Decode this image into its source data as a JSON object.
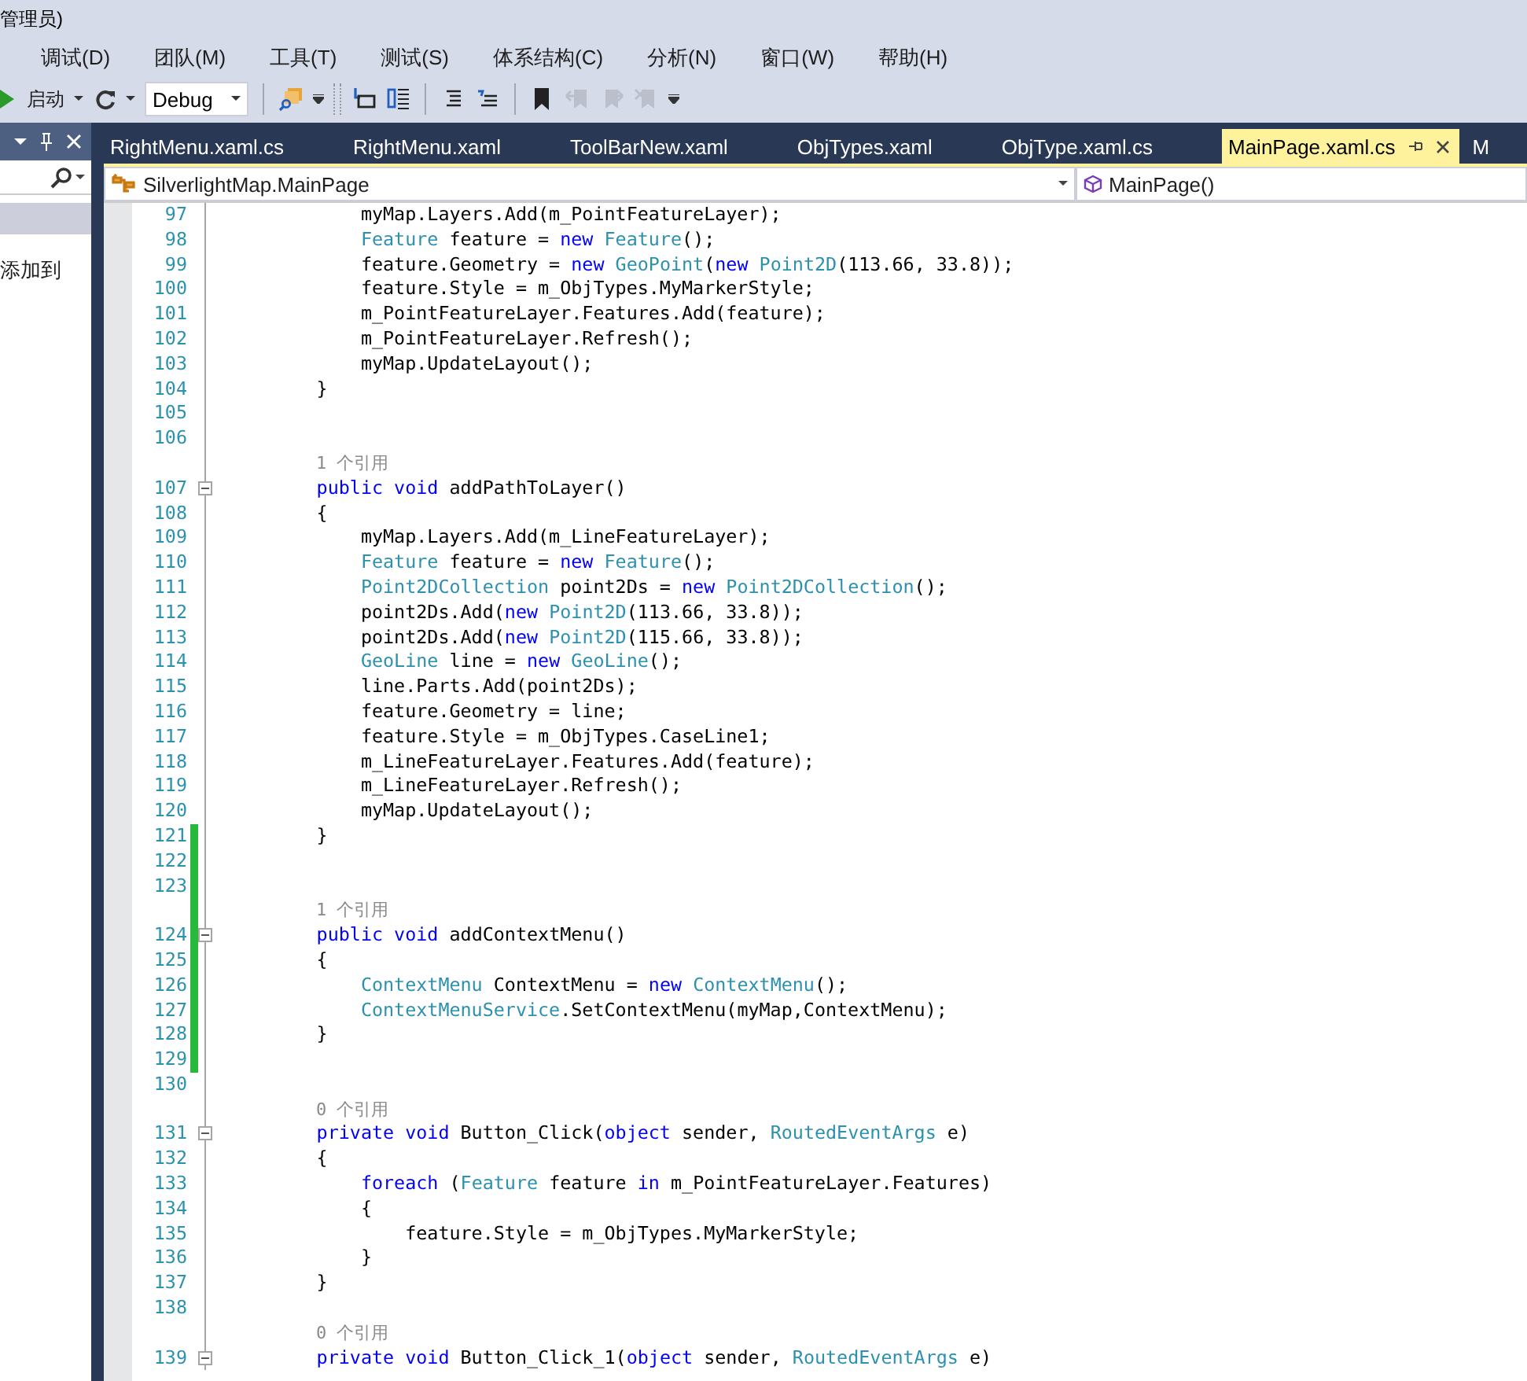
{
  "window": {
    "title": "管理员)"
  },
  "menu": [
    "调试(D)",
    "团队(M)",
    "工具(T)",
    "测试(S)",
    "体系结构(C)",
    "分析(N)",
    "窗口(W)",
    "帮助(H)"
  ],
  "toolbar": {
    "start_label": "启动",
    "configuration": "Debug",
    "buttons": [
      {
        "disabled": false
      },
      {
        "disabled": false
      },
      {
        "disabled": false
      },
      {
        "disabled": false
      },
      {
        "disabled": false
      },
      {
        "disabled": false
      },
      {
        "disabled": true
      },
      {
        "disabled": true
      },
      {
        "disabled": true
      }
    ]
  },
  "side_panel": {
    "selected_row": true,
    "text": "添加到"
  },
  "tabs": [
    {
      "label": "RightMenu.xaml.cs",
      "selected": false
    },
    {
      "label": "RightMenu.xaml",
      "selected": false
    },
    {
      "label": "ToolBarNew.xaml",
      "selected": false
    },
    {
      "label": "ObjTypes.xaml",
      "selected": false
    },
    {
      "label": "ObjType.xaml.cs",
      "selected": false
    },
    {
      "label": "MainPage.xaml.cs",
      "selected": true
    },
    {
      "label": "M",
      "selected": false
    }
  ],
  "navigation": {
    "type": "SilverlightMap.MainPage",
    "member": "MainPage()"
  },
  "code": [
    {
      "number": "97",
      "changed": false,
      "fold": false,
      "code": [
        {
          "kind": "plain",
          "text": "            myMap.Layers.Add(m_PointFeatureLayer);"
        }
      ]
    },
    {
      "number": "98",
      "changed": false,
      "fold": false,
      "code": [
        {
          "kind": "type",
          "text": "            Feature"
        },
        {
          "kind": "plain",
          "text": " feature = "
        },
        {
          "kind": "keyword",
          "text": "new "
        },
        {
          "kind": "type",
          "text": "Feature"
        },
        {
          "kind": "plain",
          "text": "();"
        }
      ]
    },
    {
      "number": "99",
      "changed": false,
      "fold": false,
      "code": [
        {
          "kind": "plain",
          "text": "            feature.Geometry = "
        },
        {
          "kind": "keyword",
          "text": "new "
        },
        {
          "kind": "type",
          "text": "GeoPoint"
        },
        {
          "kind": "plain",
          "text": "("
        },
        {
          "kind": "keyword",
          "text": "new "
        },
        {
          "kind": "type",
          "text": "Point2D"
        },
        {
          "kind": "plain",
          "text": "(113.66, 33.8));"
        }
      ]
    },
    {
      "number": "100",
      "changed": false,
      "fold": false,
      "code": [
        {
          "kind": "plain",
          "text": "            feature.Style = m_ObjTypes.MyMarkerStyle;"
        }
      ]
    },
    {
      "number": "101",
      "changed": false,
      "fold": false,
      "code": [
        {
          "kind": "plain",
          "text": "            m_PointFeatureLayer.Features.Add(feature);"
        }
      ]
    },
    {
      "number": "102",
      "changed": false,
      "fold": false,
      "code": [
        {
          "kind": "plain",
          "text": "            m_PointFeatureLayer.Refresh();"
        }
      ]
    },
    {
      "number": "103",
      "changed": false,
      "fold": false,
      "code": [
        {
          "kind": "plain",
          "text": "            myMap.UpdateLayout();"
        }
      ]
    },
    {
      "number": "104",
      "changed": false,
      "fold": false,
      "code": [
        {
          "kind": "plain",
          "text": "        }"
        }
      ]
    },
    {
      "number": "105",
      "changed": false,
      "fold": false
    },
    {
      "number": "106",
      "changed": false,
      "fold": false
    },
    {
      "kind": "codelens",
      "changed": false,
      "text": "1 个引用"
    },
    {
      "number": "107",
      "changed": false,
      "fold": true,
      "code": [
        {
          "kind": "keyword",
          "text": "        public void"
        },
        {
          "kind": "plain",
          "text": " addPathToLayer()"
        }
      ]
    },
    {
      "number": "108",
      "changed": false,
      "fold": false,
      "code": [
        {
          "kind": "plain",
          "text": "        {"
        }
      ]
    },
    {
      "number": "109",
      "changed": false,
      "fold": false,
      "code": [
        {
          "kind": "plain",
          "text": "            myMap.Layers.Add(m_LineFeatureLayer);"
        }
      ]
    },
    {
      "number": "110",
      "changed": false,
      "fold": false,
      "code": [
        {
          "kind": "type",
          "text": "            Feature"
        },
        {
          "kind": "plain",
          "text": " feature = "
        },
        {
          "kind": "keyword",
          "text": "new "
        },
        {
          "kind": "type",
          "text": "Feature"
        },
        {
          "kind": "plain",
          "text": "();"
        }
      ]
    },
    {
      "number": "111",
      "changed": false,
      "fold": false,
      "code": [
        {
          "kind": "type",
          "text": "            Point2DCollection"
        },
        {
          "kind": "plain",
          "text": " point2Ds = "
        },
        {
          "kind": "keyword",
          "text": "new "
        },
        {
          "kind": "type",
          "text": "Point2DCollection"
        },
        {
          "kind": "plain",
          "text": "();"
        }
      ]
    },
    {
      "number": "112",
      "changed": false,
      "fold": false,
      "code": [
        {
          "kind": "plain",
          "text": "            point2Ds.Add("
        },
        {
          "kind": "keyword",
          "text": "new "
        },
        {
          "kind": "type",
          "text": "Point2D"
        },
        {
          "kind": "plain",
          "text": "(113.66, 33.8));"
        }
      ]
    },
    {
      "number": "113",
      "changed": false,
      "fold": false,
      "code": [
        {
          "kind": "plain",
          "text": "            point2Ds.Add("
        },
        {
          "kind": "keyword",
          "text": "new "
        },
        {
          "kind": "type",
          "text": "Point2D"
        },
        {
          "kind": "plain",
          "text": "(115.66, 33.8));"
        }
      ]
    },
    {
      "number": "114",
      "changed": false,
      "fold": false,
      "code": [
        {
          "kind": "type",
          "text": "            GeoLine"
        },
        {
          "kind": "plain",
          "text": " line = "
        },
        {
          "kind": "keyword",
          "text": "new "
        },
        {
          "kind": "type",
          "text": "GeoLine"
        },
        {
          "kind": "plain",
          "text": "();"
        }
      ]
    },
    {
      "number": "115",
      "changed": false,
      "fold": false,
      "code": [
        {
          "kind": "plain",
          "text": "            line.Parts.Add(point2Ds);"
        }
      ]
    },
    {
      "number": "116",
      "changed": false,
      "fold": false,
      "code": [
        {
          "kind": "plain",
          "text": "            feature.Geometry = line;"
        }
      ]
    },
    {
      "number": "117",
      "changed": false,
      "fold": false,
      "code": [
        {
          "kind": "plain",
          "text": "            feature.Style = m_ObjTypes.CaseLine1;"
        }
      ]
    },
    {
      "number": "118",
      "changed": false,
      "fold": false,
      "code": [
        {
          "kind": "plain",
          "text": "            m_LineFeatureLayer.Features.Add(feature);"
        }
      ]
    },
    {
      "number": "119",
      "changed": false,
      "fold": false,
      "code": [
        {
          "kind": "plain",
          "text": "            m_LineFeatureLayer.Refresh();"
        }
      ]
    },
    {
      "number": "120",
      "changed": false,
      "fold": false,
      "code": [
        {
          "kind": "plain",
          "text": "            myMap.UpdateLayout();"
        }
      ]
    },
    {
      "number": "121",
      "changed": true,
      "fold": false,
      "code": [
        {
          "kind": "plain",
          "text": "        }"
        }
      ]
    },
    {
      "number": "122",
      "changed": true,
      "fold": false
    },
    {
      "number": "123",
      "changed": true,
      "fold": false
    },
    {
      "kind": "codelens",
      "changed": true,
      "text": "1 个引用"
    },
    {
      "number": "124",
      "changed": true,
      "fold": true,
      "code": [
        {
          "kind": "keyword",
          "text": "        public void"
        },
        {
          "kind": "plain",
          "text": " addContextMenu()"
        }
      ]
    },
    {
      "number": "125",
      "changed": true,
      "fold": false,
      "code": [
        {
          "kind": "plain",
          "text": "        {"
        }
      ]
    },
    {
      "number": "126",
      "changed": true,
      "fold": false,
      "code": [
        {
          "kind": "type",
          "text": "            ContextMenu"
        },
        {
          "kind": "plain",
          "text": " ContextMenu = "
        },
        {
          "kind": "keyword",
          "text": "new "
        },
        {
          "kind": "type",
          "text": "ContextMenu"
        },
        {
          "kind": "plain",
          "text": "();"
        }
      ]
    },
    {
      "number": "127",
      "changed": true,
      "fold": false,
      "code": [
        {
          "kind": "type",
          "text": "            ContextMenuService"
        },
        {
          "kind": "plain",
          "text": ".SetContextMenu(myMap,ContextMenu);"
        }
      ]
    },
    {
      "number": "128",
      "changed": true,
      "fold": false,
      "code": [
        {
          "kind": "plain",
          "text": "        }"
        }
      ]
    },
    {
      "number": "129",
      "changed": true,
      "fold": false
    },
    {
      "number": "130",
      "changed": false,
      "fold": false
    },
    {
      "kind": "codelens",
      "changed": false,
      "text": "0 个引用"
    },
    {
      "number": "131",
      "changed": false,
      "fold": true,
      "code": [
        {
          "kind": "keyword",
          "text": "        private void"
        },
        {
          "kind": "plain",
          "text": " Button_Click("
        },
        {
          "kind": "keyword",
          "text": "object"
        },
        {
          "kind": "plain",
          "text": " sender, "
        },
        {
          "kind": "type",
          "text": "RoutedEventArgs"
        },
        {
          "kind": "plain",
          "text": " e)"
        }
      ]
    },
    {
      "number": "132",
      "changed": false,
      "fold": false,
      "code": [
        {
          "kind": "plain",
          "text": "        {"
        }
      ]
    },
    {
      "number": "133",
      "changed": false,
      "fold": false,
      "code": [
        {
          "kind": "keyword",
          "text": "            foreach"
        },
        {
          "kind": "plain",
          "text": " ("
        },
        {
          "kind": "type",
          "text": "Feature"
        },
        {
          "kind": "plain",
          "text": " feature "
        },
        {
          "kind": "keyword",
          "text": "in"
        },
        {
          "kind": "plain",
          "text": " m_PointFeatureLayer.Features)"
        }
      ]
    },
    {
      "number": "134",
      "changed": false,
      "fold": false,
      "code": [
        {
          "kind": "plain",
          "text": "            {"
        }
      ]
    },
    {
      "number": "135",
      "changed": false,
      "fold": false,
      "code": [
        {
          "kind": "plain",
          "text": "                feature.Style = m_ObjTypes.MyMarkerStyle;"
        }
      ]
    },
    {
      "number": "136",
      "changed": false,
      "fold": false,
      "code": [
        {
          "kind": "plain",
          "text": "            }"
        }
      ]
    },
    {
      "number": "137",
      "changed": false,
      "fold": false,
      "code": [
        {
          "kind": "plain",
          "text": "        }"
        }
      ]
    },
    {
      "number": "138",
      "changed": false,
      "fold": false
    },
    {
      "kind": "codelens",
      "changed": false,
      "text": "0 个引用"
    },
    {
      "number": "139",
      "changed": false,
      "fold": true,
      "code": [
        {
          "kind": "keyword",
          "text": "        private void"
        },
        {
          "kind": "plain",
          "text": " Button_Click_1("
        },
        {
          "kind": "keyword",
          "text": "object"
        },
        {
          "kind": "plain",
          "text": " sender, "
        },
        {
          "kind": "type",
          "text": "RoutedEventArgs"
        },
        {
          "kind": "plain",
          "text": " e)"
        }
      ]
    }
  ]
}
